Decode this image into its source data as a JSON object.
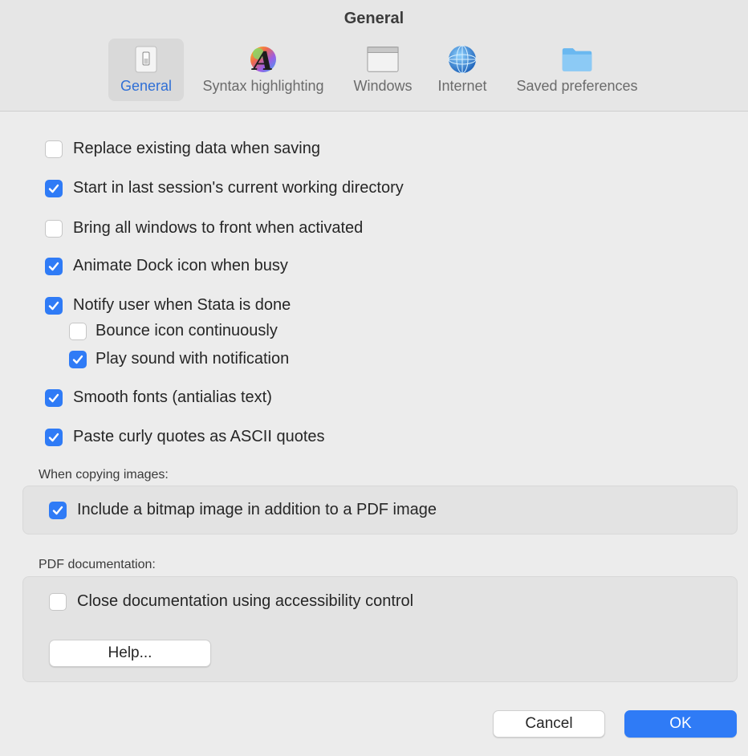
{
  "window": {
    "title": "General"
  },
  "toolbar": {
    "tabs": [
      {
        "label": "General",
        "icon": "switch-icon",
        "active": true
      },
      {
        "label": "Syntax highlighting",
        "icon": "color-font-icon",
        "active": false
      },
      {
        "label": "Windows",
        "icon": "window-icon",
        "active": false
      },
      {
        "label": "Internet",
        "icon": "globe-icon",
        "active": false
      },
      {
        "label": "Saved preferences",
        "icon": "folder-icon",
        "active": false
      }
    ]
  },
  "options": {
    "replace_existing": {
      "label": "Replace existing data when saving",
      "checked": false
    },
    "start_last_session": {
      "label": "Start in last session's current working directory",
      "checked": true
    },
    "bring_windows_front": {
      "label": "Bring all windows to front when activated",
      "checked": false
    },
    "animate_dock": {
      "label": "Animate Dock icon when busy",
      "checked": true
    },
    "notify_user": {
      "label": "Notify user when Stata is done",
      "checked": true
    },
    "bounce_icon": {
      "label": "Bounce icon continuously",
      "checked": false
    },
    "play_sound": {
      "label": "Play sound with notification",
      "checked": true
    },
    "smooth_fonts": {
      "label": "Smooth fonts (antialias text)",
      "checked": true
    },
    "paste_curly": {
      "label": "Paste curly quotes as ASCII quotes",
      "checked": true
    }
  },
  "copying_images": {
    "label": "When copying images:",
    "include_bitmap": {
      "label": "Include a bitmap image in addition to a PDF image",
      "checked": true
    }
  },
  "pdf_docs": {
    "label": "PDF documentation:",
    "close_docs": {
      "label": "Close documentation using accessibility control",
      "checked": false
    },
    "help_button": "Help..."
  },
  "footer": {
    "cancel_label": "Cancel",
    "ok_label": "OK"
  },
  "colors": {
    "accent": "#2f7bf6",
    "active_tab_text": "#2f6fd6"
  }
}
